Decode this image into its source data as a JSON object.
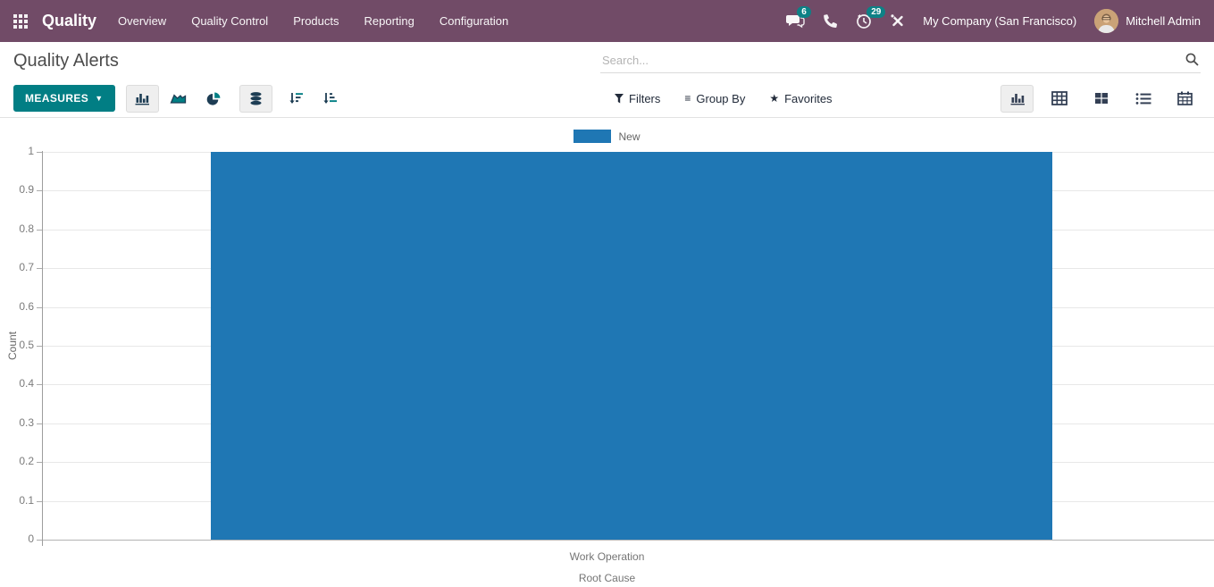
{
  "navbar": {
    "brand": "Quality",
    "menu": [
      "Overview",
      "Quality Control",
      "Products",
      "Reporting",
      "Configuration"
    ],
    "messages_badge": "6",
    "activities_badge": "29",
    "company": "My Company (San Francisco)",
    "user": "Mitchell Admin"
  },
  "control_panel": {
    "title": "Quality Alerts",
    "search_placeholder": "Search...",
    "measures_label": "MEASURES",
    "measures_caret": "▼",
    "filters_label": "Filters",
    "group_by_label": "Group By",
    "group_by_glyph": "≡",
    "favorites_label": "Favorites",
    "favorites_glyph": "★"
  },
  "icons": {
    "apps_menu": "grid-icon",
    "messages": "chat-bubbles-icon",
    "phone": "phone-icon",
    "activities": "clock-icon",
    "tools": "wrench-icon",
    "search": "magnifier-icon",
    "filters": "funnel-icon",
    "chart_types": [
      "bar-chart-icon",
      "area-chart-icon",
      "pie-chart-icon",
      "stacked-icon"
    ],
    "sort": [
      "sort-desc-icon",
      "sort-asc-icon"
    ],
    "view_switcher": [
      "graph-view-icon",
      "pivot-view-icon",
      "kanban-view-icon",
      "list-view-icon",
      "calendar-view-icon"
    ]
  },
  "colors": {
    "navbar_bg": "#714b67",
    "accent_teal": "#017e84",
    "badge_teal": "#0d8186",
    "bar_blue": "#1f77b4",
    "icon_dark": "#1d3d54"
  },
  "chart_data": {
    "type": "bar",
    "title": "",
    "categories": [
      "Work Operation"
    ],
    "series": [
      {
        "name": "New",
        "values": [
          1
        ],
        "color": "#1f77b4"
      }
    ],
    "xlabel": "Root Cause",
    "ylabel": "Count",
    "ylim": [
      0,
      1
    ],
    "ytick_step": 0.1,
    "grid": true,
    "legend_position": "top"
  }
}
